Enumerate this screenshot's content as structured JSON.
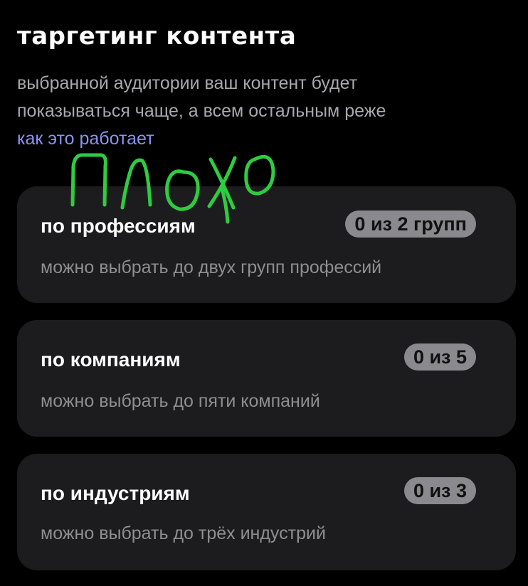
{
  "header": {
    "title": "таргетинг контента",
    "description_lines": [
      "выбранной аудитории ваш контент будет",
      "показываться чаще, а всем остальным реже"
    ],
    "link_label": "как это работает"
  },
  "cards": [
    {
      "title": "по профессиям",
      "subtitle": "можно выбрать до двух групп профессий",
      "counter": "0 из 2 групп"
    },
    {
      "title": "по компаниям",
      "subtitle": "можно выбрать до пяти компаний",
      "counter": "0 из 5"
    },
    {
      "title": "по индустриям",
      "subtitle": "можно выбрать до трёх индустрий",
      "counter": "0 из 3"
    }
  ],
  "annotation": {
    "handwritten_text": "плохо",
    "color": "#2ecc40"
  },
  "colors": {
    "background": "#000000",
    "card_background": "#1c1c1e",
    "link": "#8b93f2",
    "badge_background": "#8a8a8e"
  }
}
